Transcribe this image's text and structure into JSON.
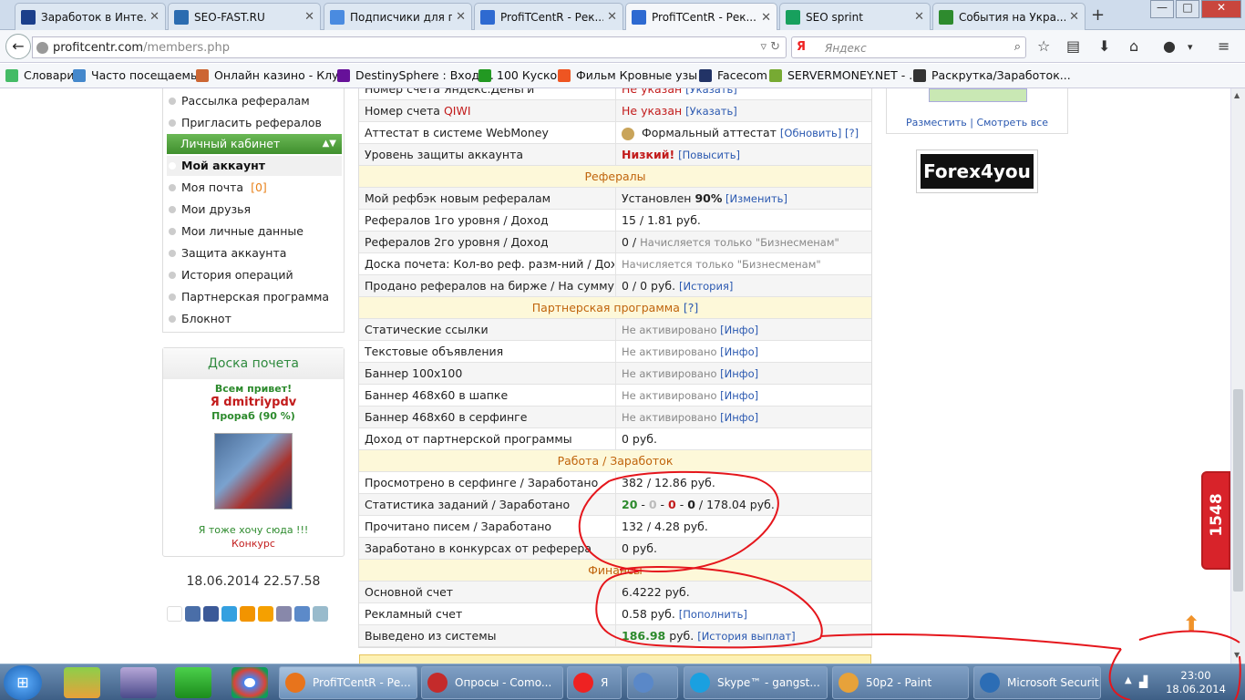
{
  "browser": {
    "tabs": [
      {
        "title": "Заработок в Инте...",
        "favicon": "ZONA",
        "color": "#1b3f8b"
      },
      {
        "title": "SEO-FAST.RU",
        "favicon": "SF",
        "color": "#2b6cb0"
      },
      {
        "title": "Подписчики для г...",
        "favicon": "heart",
        "color": "#4a8be0"
      },
      {
        "title": "ProfiTCentR - Рек...",
        "favicon": "bars",
        "color": "#2e6ad1"
      },
      {
        "title": "ProfiTCentR - Рек...",
        "favicon": "bars",
        "color": "#2e6ad1",
        "active": true
      },
      {
        "title": "SEO sprint",
        "favicon": "S",
        "color": "#17a05d"
      },
      {
        "title": "События на Укра...",
        "favicon": "news",
        "color": "#2e8b2e"
      }
    ],
    "close_glyph": "✕",
    "new_tab": "+",
    "url_host": "profitcentr.com",
    "url_path": "/members.php",
    "search_engine": "Я",
    "search_placeholder": "Яндекс"
  },
  "bookmarks": [
    {
      "label": "Словари",
      "color": "#4b6"
    },
    {
      "label": "Часто посещаемые",
      "color": "#48c"
    },
    {
      "label": "Онлайн казино - Клу...",
      "color": "#c63"
    },
    {
      "label": "DestinySphere : Вход ...",
      "color": "#619"
    },
    {
      "label": "100 Кусков",
      "color": "#292"
    },
    {
      "label": "Фильм Кровные узы ...",
      "color": "#e52"
    },
    {
      "label": "Facecom",
      "color": "#236"
    },
    {
      "label": "SERVERMONEY.NET - ...",
      "color": "#7a3"
    },
    {
      "label": "Раскрутка/Заработок...",
      "color": "#333"
    }
  ],
  "sidebar": {
    "items_top": [
      "Рассылка рефералам",
      "Пригласить рефералов"
    ],
    "section": "Личный кабинет",
    "items": [
      {
        "label": "Мой аккаунт",
        "active": true
      },
      {
        "label": "Моя почта",
        "count": "[0]"
      },
      {
        "label": "Мои друзья"
      },
      {
        "label": "Мои личные данные"
      },
      {
        "label": "Защита аккаунта"
      },
      {
        "label": "История операций"
      },
      {
        "label": "Партнерская программа"
      },
      {
        "label": "Блокнот"
      }
    ]
  },
  "board": {
    "title": "Доска почета",
    "greeting": "Всем привет!",
    "user": "Я dmitriypdv",
    "rank": "Прораб (90 %)",
    "want": "Я тоже хочу сюда !!!",
    "contest": "Конкурс"
  },
  "datetime": "18.06.2014 22.57.58",
  "account": {
    "rows_top": [
      {
        "label": "Номер счета Яндекс.Деньги",
        "value": "Не указан",
        "link": "[Указать]"
      },
      {
        "label": "Номер счета ",
        "qiwi": "QIWI",
        "value": "Не указан",
        "link": "[Указать]"
      },
      {
        "label": "Аттестат в системе WebMoney",
        "value": "Формальный аттестат",
        "link": "[Обновить] [?]"
      },
      {
        "label": "Уровень защиты аккаунта",
        "value": "Низкий!",
        "link": "[Повысить]"
      }
    ],
    "sec_refs": "Рефералы",
    "rows_refs": [
      {
        "label": "Мой рефбэк новым рефералам",
        "pre": "Установлен ",
        "bold": "90%",
        "link": " [Изменить]"
      },
      {
        "label": "Рефералов 1го уровня / Доход",
        "value": "15 / 1.81 руб."
      },
      {
        "label": "Рефералов 2го уровня / Доход",
        "value": "0 / ",
        "note": "Начисляется только \"Бизнесменам\""
      },
      {
        "label": "Доска почета: Кол-во реф. разм-ний / Доход",
        "note": "Начисляется только \"Бизнесменам\""
      },
      {
        "label": "Продано рефералов на бирже / На сумму",
        "value": "0 / 0 руб. ",
        "link": "[История]"
      }
    ],
    "sec_partner": "Партнерская программа",
    "sec_partner_q": "[?]",
    "rows_partner": [
      {
        "label": "Статические ссылки",
        "note": "Не активировано ",
        "link": "[Инфо]"
      },
      {
        "label": "Текстовые объявления",
        "note": "Не активировано ",
        "link": "[Инфо]"
      },
      {
        "label": "Баннер 100x100",
        "note": "Не активировано ",
        "link": "[Инфо]"
      },
      {
        "label": "Баннер 468x60 в шапке",
        "note": "Не активировано ",
        "link": "[Инфо]"
      },
      {
        "label": "Баннер 468x60 в серфинге",
        "note": "Не активировано ",
        "link": "[Инфо]"
      },
      {
        "label": "Доход от партнерской программы",
        "value": "0 руб."
      }
    ],
    "sec_work": "Работа / Заработок",
    "rows_work": [
      {
        "label": "Просмотрено в серфинге / Заработано",
        "value": "382 / 12.86 руб."
      },
      {
        "label": "Статистика заданий / Заработано",
        "tasks": [
          "20",
          "0",
          "0",
          "0"
        ],
        "value": " / 178.04 руб."
      },
      {
        "label": "Прочитано писем / Заработано",
        "value": "132 / 4.28 руб."
      },
      {
        "label": "Заработано в конкурсах от реферера",
        "value": "0 руб."
      }
    ],
    "sec_fin": "Финансы",
    "rows_fin": [
      {
        "label": "Основной счет",
        "value": "6.4222 руб."
      },
      {
        "label": "Рекламный счет",
        "value": "0.58 руб. ",
        "link": "[Пополнить]"
      },
      {
        "label": "Выведено из системы",
        "bold": "186.98",
        "value": " руб. ",
        "link": "[История выплат]"
      }
    ]
  },
  "right": {
    "links": "Разместить | Смотреть все",
    "forex": "Forex4you",
    "counter": "1548"
  },
  "taskbar": {
    "windows": [
      {
        "label": "ProfiTCentR - Ре...",
        "color": "#e8741c",
        "active": true
      },
      {
        "label": "Опросы - Сomo...",
        "color": "#c42b2b"
      },
      {
        "label": "Я",
        "color": "#e22"
      },
      {
        "label": "",
        "color": "#5a88c8"
      },
      {
        "label": "Skype™ - gangst...",
        "color": "#1aa0e0"
      },
      {
        "label": "50p2 - Paint",
        "color": "#e7a23a"
      },
      {
        "label": "Microsoft Securit...",
        "color": "#2c6db5"
      }
    ],
    "time": "23:00",
    "date": "18.06.2014"
  }
}
